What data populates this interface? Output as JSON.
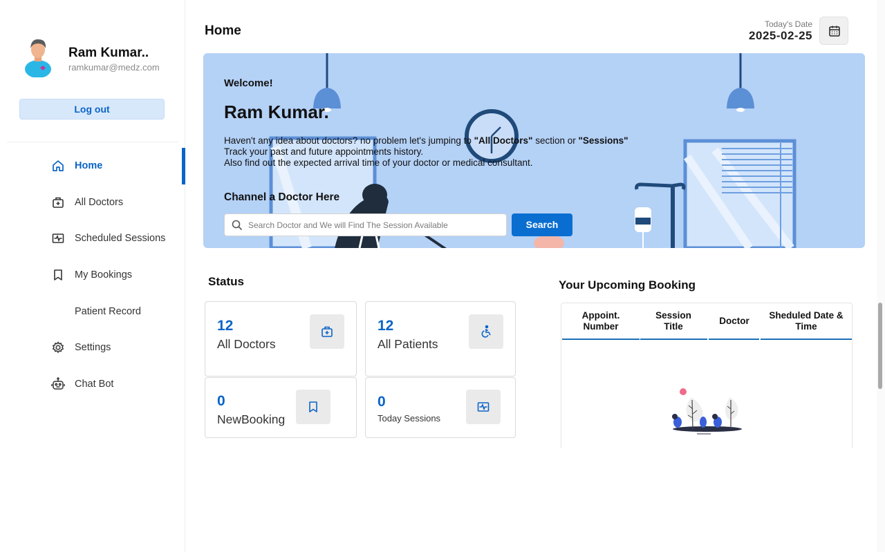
{
  "sidebar": {
    "profile": {
      "name": "Ram Kumar..",
      "email": "ramkumar@medz.com"
    },
    "logout_label": "Log out",
    "items": [
      {
        "label": "Home",
        "icon": "home-icon"
      },
      {
        "label": "All Doctors",
        "icon": "medical-bag-icon"
      },
      {
        "label": "Scheduled Sessions",
        "icon": "pulse-icon"
      },
      {
        "label": "My Bookings",
        "icon": "bookmark-icon"
      },
      {
        "label": "Patient Record",
        "icon": ""
      },
      {
        "label": "Settings",
        "icon": "gear-icon"
      },
      {
        "label": "Chat Bot",
        "icon": "robot-icon"
      }
    ]
  },
  "header": {
    "title": "Home",
    "date_label": "Today's Date",
    "date_value": "2025-02-25"
  },
  "hero": {
    "welcome": "Welcome!",
    "name": "Ram Kumar.",
    "line1_a": "Haven't any idea about doctors? no problem let's jumping to ",
    "line1_b": "\"All Doctors\"",
    "line1_c": " section or ",
    "line1_d": "\"Sessions\"",
    "line2": "Track your past and future appointments history.",
    "line3": "Also find out the expected arrival time of your doctor or medical consultant.",
    "channel_title": "Channel a Doctor Here",
    "search_placeholder": "Search Doctor and We will Find The Session Available",
    "search_button": "Search"
  },
  "status": {
    "title": "Status",
    "cards": [
      {
        "value": "12",
        "label": "All Doctors",
        "icon": "medical-bag-icon"
      },
      {
        "value": "12",
        "label": "All Patients",
        "icon": "wheelchair-icon"
      },
      {
        "value": "0",
        "label": "NewBooking",
        "icon": "bookmark-icon"
      },
      {
        "value": "0",
        "label": "Today Sessions",
        "icon": "pulse-icon"
      }
    ]
  },
  "booking": {
    "title": "Your Upcoming Booking",
    "columns": [
      "Appoint. Number",
      "Session Title",
      "Doctor",
      "Sheduled Date & Time"
    ]
  },
  "colors": {
    "accent": "#0a64c7",
    "hero_bg": "#b4d1f6"
  }
}
